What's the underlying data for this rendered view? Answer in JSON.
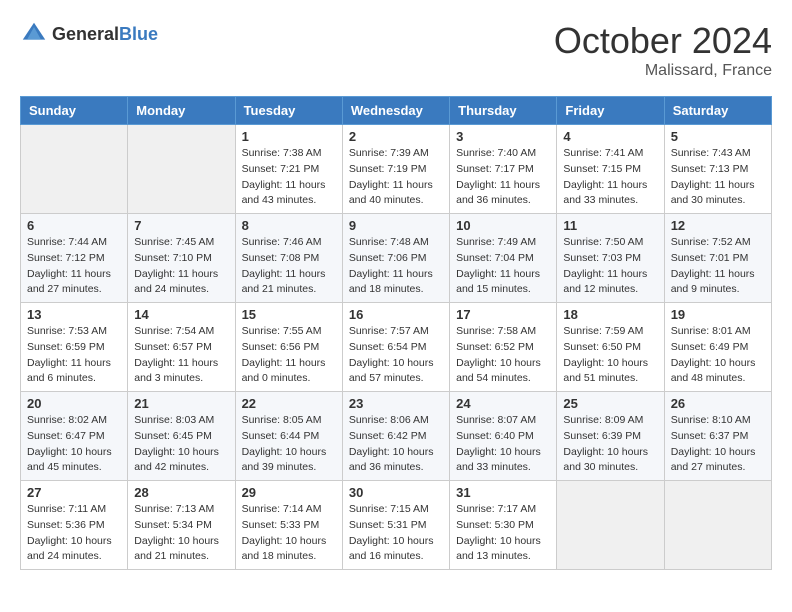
{
  "header": {
    "logo_general": "General",
    "logo_blue": "Blue",
    "month_title": "October 2024",
    "location": "Malissard, France"
  },
  "weekdays": [
    "Sunday",
    "Monday",
    "Tuesday",
    "Wednesday",
    "Thursday",
    "Friday",
    "Saturday"
  ],
  "weeks": [
    [
      {
        "day": "",
        "sunrise": "",
        "sunset": "",
        "daylight": ""
      },
      {
        "day": "",
        "sunrise": "",
        "sunset": "",
        "daylight": ""
      },
      {
        "day": "1",
        "sunrise": "Sunrise: 7:38 AM",
        "sunset": "Sunset: 7:21 PM",
        "daylight": "Daylight: 11 hours and 43 minutes."
      },
      {
        "day": "2",
        "sunrise": "Sunrise: 7:39 AM",
        "sunset": "Sunset: 7:19 PM",
        "daylight": "Daylight: 11 hours and 40 minutes."
      },
      {
        "day": "3",
        "sunrise": "Sunrise: 7:40 AM",
        "sunset": "Sunset: 7:17 PM",
        "daylight": "Daylight: 11 hours and 36 minutes."
      },
      {
        "day": "4",
        "sunrise": "Sunrise: 7:41 AM",
        "sunset": "Sunset: 7:15 PM",
        "daylight": "Daylight: 11 hours and 33 minutes."
      },
      {
        "day": "5",
        "sunrise": "Sunrise: 7:43 AM",
        "sunset": "Sunset: 7:13 PM",
        "daylight": "Daylight: 11 hours and 30 minutes."
      }
    ],
    [
      {
        "day": "6",
        "sunrise": "Sunrise: 7:44 AM",
        "sunset": "Sunset: 7:12 PM",
        "daylight": "Daylight: 11 hours and 27 minutes."
      },
      {
        "day": "7",
        "sunrise": "Sunrise: 7:45 AM",
        "sunset": "Sunset: 7:10 PM",
        "daylight": "Daylight: 11 hours and 24 minutes."
      },
      {
        "day": "8",
        "sunrise": "Sunrise: 7:46 AM",
        "sunset": "Sunset: 7:08 PM",
        "daylight": "Daylight: 11 hours and 21 minutes."
      },
      {
        "day": "9",
        "sunrise": "Sunrise: 7:48 AM",
        "sunset": "Sunset: 7:06 PM",
        "daylight": "Daylight: 11 hours and 18 minutes."
      },
      {
        "day": "10",
        "sunrise": "Sunrise: 7:49 AM",
        "sunset": "Sunset: 7:04 PM",
        "daylight": "Daylight: 11 hours and 15 minutes."
      },
      {
        "day": "11",
        "sunrise": "Sunrise: 7:50 AM",
        "sunset": "Sunset: 7:03 PM",
        "daylight": "Daylight: 11 hours and 12 minutes."
      },
      {
        "day": "12",
        "sunrise": "Sunrise: 7:52 AM",
        "sunset": "Sunset: 7:01 PM",
        "daylight": "Daylight: 11 hours and 9 minutes."
      }
    ],
    [
      {
        "day": "13",
        "sunrise": "Sunrise: 7:53 AM",
        "sunset": "Sunset: 6:59 PM",
        "daylight": "Daylight: 11 hours and 6 minutes."
      },
      {
        "day": "14",
        "sunrise": "Sunrise: 7:54 AM",
        "sunset": "Sunset: 6:57 PM",
        "daylight": "Daylight: 11 hours and 3 minutes."
      },
      {
        "day": "15",
        "sunrise": "Sunrise: 7:55 AM",
        "sunset": "Sunset: 6:56 PM",
        "daylight": "Daylight: 11 hours and 0 minutes."
      },
      {
        "day": "16",
        "sunrise": "Sunrise: 7:57 AM",
        "sunset": "Sunset: 6:54 PM",
        "daylight": "Daylight: 10 hours and 57 minutes."
      },
      {
        "day": "17",
        "sunrise": "Sunrise: 7:58 AM",
        "sunset": "Sunset: 6:52 PM",
        "daylight": "Daylight: 10 hours and 54 minutes."
      },
      {
        "day": "18",
        "sunrise": "Sunrise: 7:59 AM",
        "sunset": "Sunset: 6:50 PM",
        "daylight": "Daylight: 10 hours and 51 minutes."
      },
      {
        "day": "19",
        "sunrise": "Sunrise: 8:01 AM",
        "sunset": "Sunset: 6:49 PM",
        "daylight": "Daylight: 10 hours and 48 minutes."
      }
    ],
    [
      {
        "day": "20",
        "sunrise": "Sunrise: 8:02 AM",
        "sunset": "Sunset: 6:47 PM",
        "daylight": "Daylight: 10 hours and 45 minutes."
      },
      {
        "day": "21",
        "sunrise": "Sunrise: 8:03 AM",
        "sunset": "Sunset: 6:45 PM",
        "daylight": "Daylight: 10 hours and 42 minutes."
      },
      {
        "day": "22",
        "sunrise": "Sunrise: 8:05 AM",
        "sunset": "Sunset: 6:44 PM",
        "daylight": "Daylight: 10 hours and 39 minutes."
      },
      {
        "day": "23",
        "sunrise": "Sunrise: 8:06 AM",
        "sunset": "Sunset: 6:42 PM",
        "daylight": "Daylight: 10 hours and 36 minutes."
      },
      {
        "day": "24",
        "sunrise": "Sunrise: 8:07 AM",
        "sunset": "Sunset: 6:40 PM",
        "daylight": "Daylight: 10 hours and 33 minutes."
      },
      {
        "day": "25",
        "sunrise": "Sunrise: 8:09 AM",
        "sunset": "Sunset: 6:39 PM",
        "daylight": "Daylight: 10 hours and 30 minutes."
      },
      {
        "day": "26",
        "sunrise": "Sunrise: 8:10 AM",
        "sunset": "Sunset: 6:37 PM",
        "daylight": "Daylight: 10 hours and 27 minutes."
      }
    ],
    [
      {
        "day": "27",
        "sunrise": "Sunrise: 7:11 AM",
        "sunset": "Sunset: 5:36 PM",
        "daylight": "Daylight: 10 hours and 24 minutes."
      },
      {
        "day": "28",
        "sunrise": "Sunrise: 7:13 AM",
        "sunset": "Sunset: 5:34 PM",
        "daylight": "Daylight: 10 hours and 21 minutes."
      },
      {
        "day": "29",
        "sunrise": "Sunrise: 7:14 AM",
        "sunset": "Sunset: 5:33 PM",
        "daylight": "Daylight: 10 hours and 18 minutes."
      },
      {
        "day": "30",
        "sunrise": "Sunrise: 7:15 AM",
        "sunset": "Sunset: 5:31 PM",
        "daylight": "Daylight: 10 hours and 16 minutes."
      },
      {
        "day": "31",
        "sunrise": "Sunrise: 7:17 AM",
        "sunset": "Sunset: 5:30 PM",
        "daylight": "Daylight: 10 hours and 13 minutes."
      },
      {
        "day": "",
        "sunrise": "",
        "sunset": "",
        "daylight": ""
      },
      {
        "day": "",
        "sunrise": "",
        "sunset": "",
        "daylight": ""
      }
    ]
  ]
}
